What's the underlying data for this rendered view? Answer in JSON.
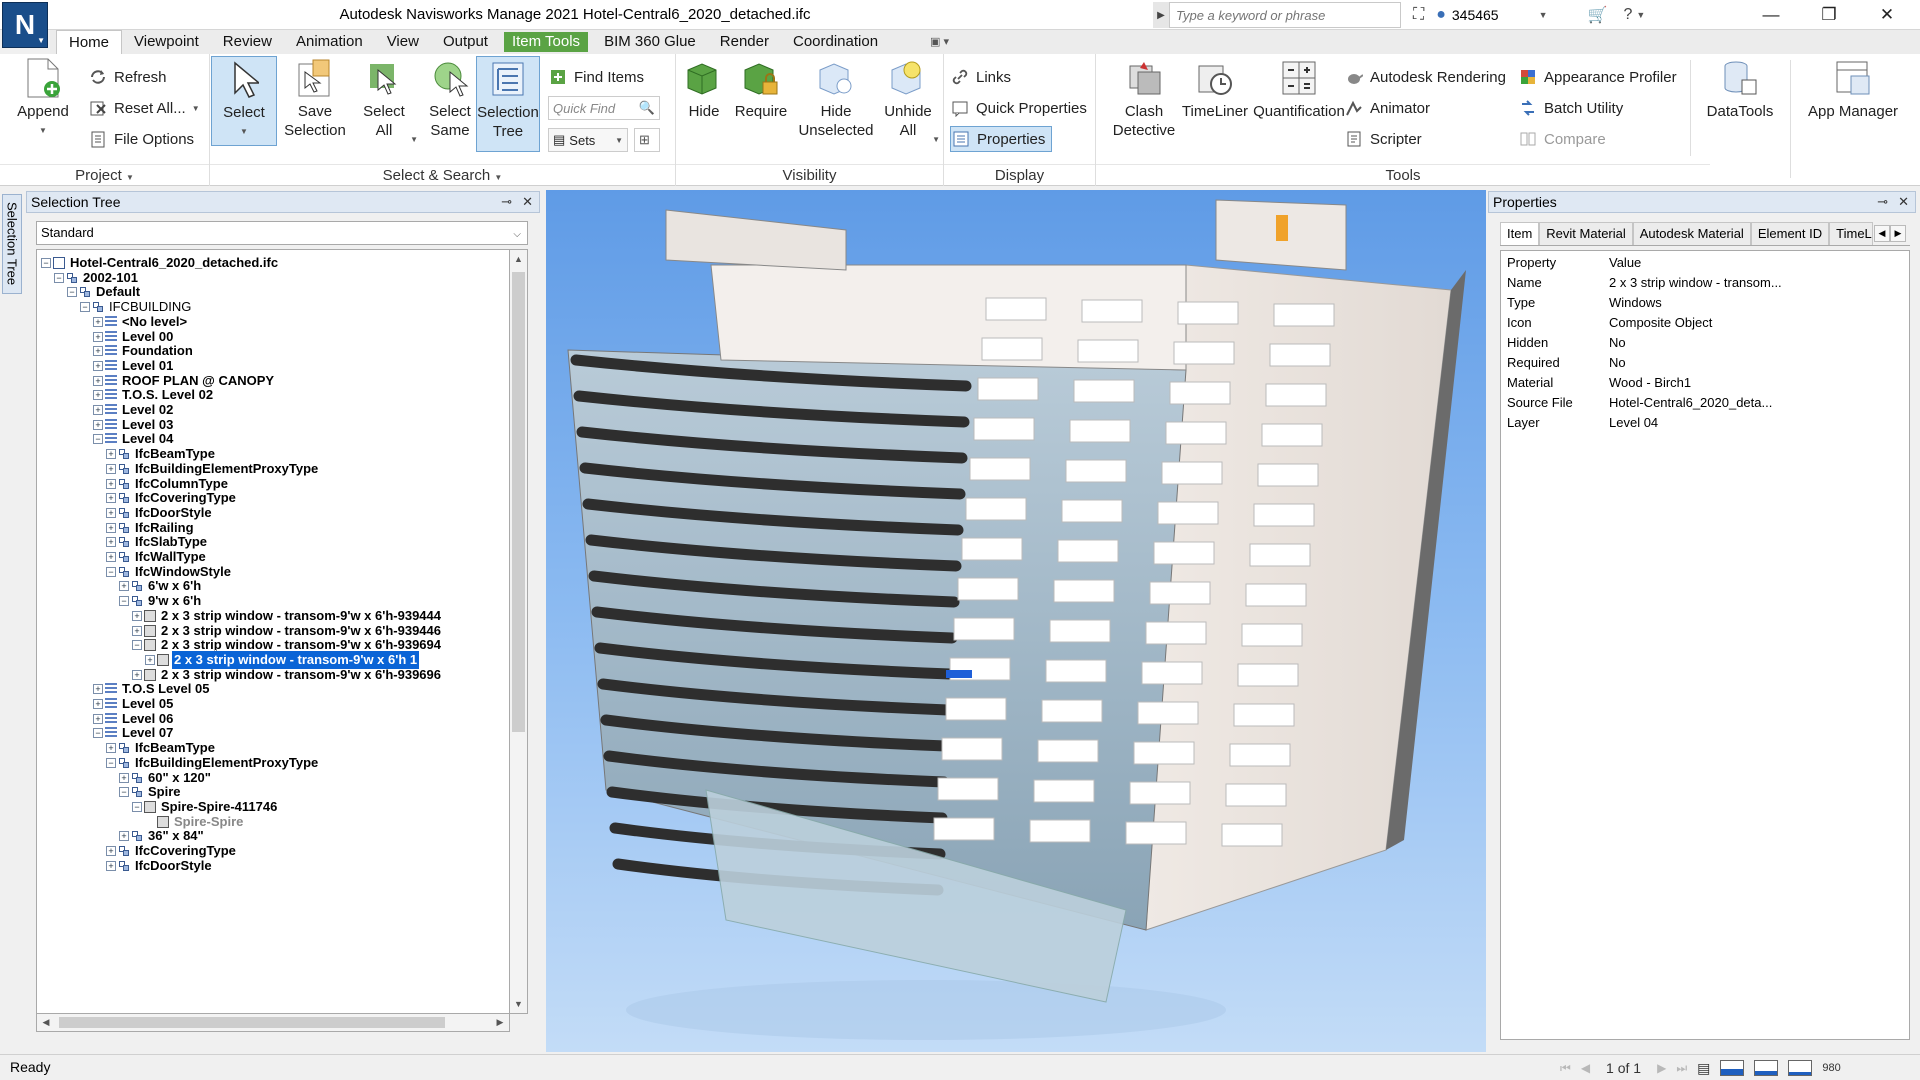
{
  "app": {
    "title": "Autodesk Navisworks Manage 2021    Hotel-Central6_2020_detached.ifc",
    "logo_letter": "N",
    "search_placeholder": "Type a keyword or phrase",
    "user": "345465"
  },
  "menu_tabs": [
    "Home",
    "Viewpoint",
    "Review",
    "Animation",
    "View",
    "Output",
    "Item Tools",
    "BIM 360 Glue",
    "Render",
    "Coordination"
  ],
  "ribbon": {
    "project": {
      "label": "Project",
      "append": "Append",
      "refresh": "Refresh",
      "reset_all": "Reset All...",
      "file_options": "File Options"
    },
    "select_search": {
      "label": "Select & Search",
      "select": "Select",
      "save_selection_1": "Save",
      "save_selection_2": "Selection",
      "select_all_1": "Select",
      "select_all_2": "All",
      "select_same_1": "Select",
      "select_same_2": "Same",
      "selection_tree_1": "Selection",
      "selection_tree_2": "Tree",
      "find_items": "Find Items",
      "quick_find_placeholder": "Quick Find",
      "sets": "Sets"
    },
    "visibility": {
      "label": "Visibility",
      "hide": "Hide",
      "require": "Require",
      "hide_unselected_1": "Hide",
      "hide_unselected_2": "Unselected",
      "unhide_all_1": "Unhide",
      "unhide_all_2": "All"
    },
    "display": {
      "label": "Display",
      "links": "Links",
      "quick_properties": "Quick Properties",
      "properties": "Properties"
    },
    "tools": {
      "label": "Tools",
      "clash_1": "Clash",
      "clash_2": "Detective",
      "timeliner": "TimeLiner",
      "quantification": "Quantification",
      "autodesk_rendering": "Autodesk Rendering",
      "animator": "Animator",
      "scripter": "Scripter",
      "appearance_profiler": "Appearance Profiler",
      "batch_utility": "Batch Utility",
      "compare": "Compare",
      "datatools": "DataTools",
      "app_manager": "App Manager"
    }
  },
  "selection_tree": {
    "title": "Selection Tree",
    "side_tab": "Selection Tree",
    "mode": "Standard",
    "rows": [
      {
        "d": 0,
        "t": "Hotel-Central6_2020_detached.ifc",
        "e": "-",
        "i": "file"
      },
      {
        "d": 1,
        "t": "2002-101",
        "e": "-",
        "i": "grp"
      },
      {
        "d": 2,
        "t": "Default",
        "e": "-",
        "i": "grp"
      },
      {
        "d": 3,
        "t": "IFCBUILDING",
        "e": "-",
        "i": "grp",
        "thin": true
      },
      {
        "d": 4,
        "t": "<No level>",
        "e": "+",
        "i": "lvl"
      },
      {
        "d": 4,
        "t": "Level 00",
        "e": "+",
        "i": "lvl"
      },
      {
        "d": 4,
        "t": "Foundation",
        "e": "+",
        "i": "lvl"
      },
      {
        "d": 4,
        "t": "Level 01",
        "e": "+",
        "i": "lvl"
      },
      {
        "d": 4,
        "t": "ROOF PLAN @ CANOPY",
        "e": "+",
        "i": "lvl"
      },
      {
        "d": 4,
        "t": "T.O.S. Level 02",
        "e": "+",
        "i": "lvl"
      },
      {
        "d": 4,
        "t": "Level 02",
        "e": "+",
        "i": "lvl"
      },
      {
        "d": 4,
        "t": "Level 03",
        "e": "+",
        "i": "lvl"
      },
      {
        "d": 4,
        "t": "Level 04",
        "e": "-",
        "i": "lvl"
      },
      {
        "d": 5,
        "t": "IfcBeamType",
        "e": "+",
        "i": "grp"
      },
      {
        "d": 5,
        "t": "IfcBuildingElementProxyType",
        "e": "+",
        "i": "grp"
      },
      {
        "d": 5,
        "t": "IfcColumnType",
        "e": "+",
        "i": "grp"
      },
      {
        "d": 5,
        "t": "IfcCoveringType",
        "e": "+",
        "i": "grp"
      },
      {
        "d": 5,
        "t": "IfcDoorStyle",
        "e": "+",
        "i": "grp"
      },
      {
        "d": 5,
        "t": "IfcRailing",
        "e": "+",
        "i": "grp"
      },
      {
        "d": 5,
        "t": "IfcSlabType",
        "e": "+",
        "i": "grp"
      },
      {
        "d": 5,
        "t": "IfcWallType",
        "e": "+",
        "i": "grp"
      },
      {
        "d": 5,
        "t": "IfcWindowStyle",
        "e": "-",
        "i": "grp"
      },
      {
        "d": 6,
        "t": "6'w x 6'h",
        "e": "+",
        "i": "grp"
      },
      {
        "d": 6,
        "t": "9'w x 6'h",
        "e": "-",
        "i": "grp"
      },
      {
        "d": 7,
        "t": "2 x 3 strip window - transom-9'w x 6'h-939444",
        "e": "+",
        "i": "geo"
      },
      {
        "d": 7,
        "t": "2 x 3 strip window - transom-9'w x 6'h-939446",
        "e": "+",
        "i": "geo"
      },
      {
        "d": 7,
        "t": "2 x 3 strip window - transom-9'w x 6'h-939694",
        "e": "-",
        "i": "geo"
      },
      {
        "d": 8,
        "t": "2 x 3 strip window - transom-9'w x 6'h 1",
        "e": "+",
        "i": "geo",
        "hl": true
      },
      {
        "d": 7,
        "t": "2 x 3 strip window - transom-9'w x 6'h-939696",
        "e": "+",
        "i": "geo"
      },
      {
        "d": 4,
        "t": "T.O.S Level 05",
        "e": "+",
        "i": "lvl"
      },
      {
        "d": 4,
        "t": "Level 05",
        "e": "+",
        "i": "lvl"
      },
      {
        "d": 4,
        "t": "Level 06",
        "e": "+",
        "i": "lvl"
      },
      {
        "d": 4,
        "t": "Level 07",
        "e": "-",
        "i": "lvl"
      },
      {
        "d": 5,
        "t": "IfcBeamType",
        "e": "+",
        "i": "grp"
      },
      {
        "d": 5,
        "t": "IfcBuildingElementProxyType",
        "e": "-",
        "i": "grp"
      },
      {
        "d": 6,
        "t": "60\" x 120\"",
        "e": "+",
        "i": "grp"
      },
      {
        "d": 6,
        "t": "Spire",
        "e": "-",
        "i": "grp"
      },
      {
        "d": 7,
        "t": "Spire-Spire-411746",
        "e": "-",
        "i": "geo"
      },
      {
        "d": 8,
        "t": "Spire-Spire",
        "e": "",
        "i": "geo",
        "grey": true
      },
      {
        "d": 6,
        "t": "36\" x 84\"",
        "e": "+",
        "i": "grp"
      },
      {
        "d": 5,
        "t": "IfcCoveringType",
        "e": "+",
        "i": "grp"
      },
      {
        "d": 5,
        "t": "IfcDoorStyle",
        "e": "+",
        "i": "grp"
      }
    ]
  },
  "properties": {
    "title": "Properties",
    "tabs": [
      "Item",
      "Revit Material",
      "Autodesk Material",
      "Element ID",
      "TimeLi"
    ],
    "header": {
      "k": "Property",
      "v": "Value"
    },
    "rows": [
      {
        "k": "Name",
        "v": "2 x 3 strip window - transom..."
      },
      {
        "k": "Type",
        "v": "Windows"
      },
      {
        "k": "Icon",
        "v": "Composite Object"
      },
      {
        "k": "Hidden",
        "v": "No"
      },
      {
        "k": "Required",
        "v": "No"
      },
      {
        "k": "Material",
        "v": "Wood - Birch1"
      },
      {
        "k": "Source File",
        "v": "Hotel-Central6_2020_deta..."
      },
      {
        "k": "Layer",
        "v": "Level 04"
      }
    ]
  },
  "status": {
    "text": "Ready",
    "page": "1 of 1",
    "memory": "980"
  },
  "colors": {
    "accent": "#5aa344",
    "selection": "#0a64d6",
    "sky_top": "#5f9be6",
    "sky_bottom": "#c3dcf7"
  }
}
